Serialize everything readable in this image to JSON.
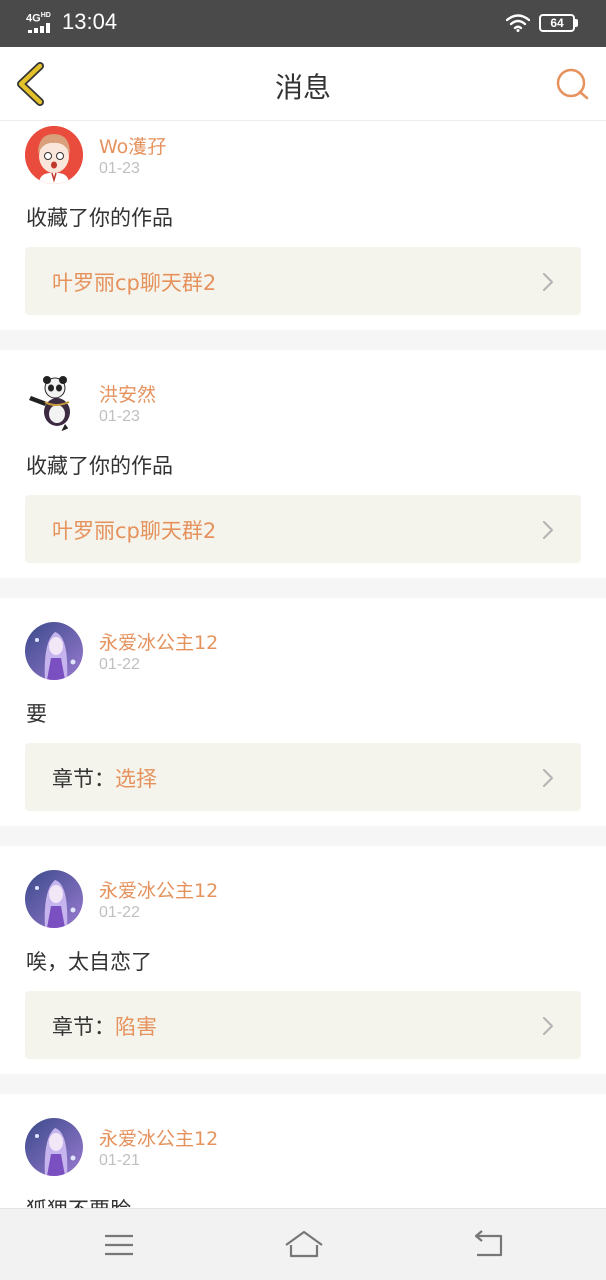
{
  "status_bar": {
    "network": "4G",
    "network_sup": "HD",
    "time": "13:04",
    "battery": "64"
  },
  "header": {
    "title": "消息",
    "back_icon": "chevron-left-icon",
    "search_icon": "search-icon",
    "accent_color": "#e5925d",
    "back_color": "#e2c12a"
  },
  "messages": [
    {
      "username": "Wo濩孖",
      "date": "01-23",
      "text": "收藏了你的作品",
      "work_prefix": "",
      "work_title": "叶罗丽cp聊天群2",
      "avatar": "avatar-girl-pink-hair"
    },
    {
      "username": "洪安然",
      "date": "01-23",
      "text": "收藏了你的作品",
      "work_prefix": "",
      "work_title": "叶罗丽cp聊天群2",
      "avatar": "avatar-kung-fu-panda"
    },
    {
      "username": "永爱冰公主12",
      "date": "01-22",
      "text": "要",
      "work_prefix": "章节：",
      "work_title": "选择",
      "avatar": "avatar-anime-princess"
    },
    {
      "username": "永爱冰公主12",
      "date": "01-22",
      "text": "唉，太自恋了",
      "work_prefix": "章节：",
      "work_title": "陷害",
      "avatar": "avatar-anime-princess"
    },
    {
      "username": "永爱冰公主12",
      "date": "01-21",
      "text": "狐狸不要脸",
      "work_prefix": "",
      "work_title": "",
      "avatar": "avatar-anime-princess"
    }
  ],
  "bottom_nav": {
    "menu_icon": "menu-icon",
    "home_icon": "home-icon",
    "back_icon": "back-arrow-icon"
  }
}
